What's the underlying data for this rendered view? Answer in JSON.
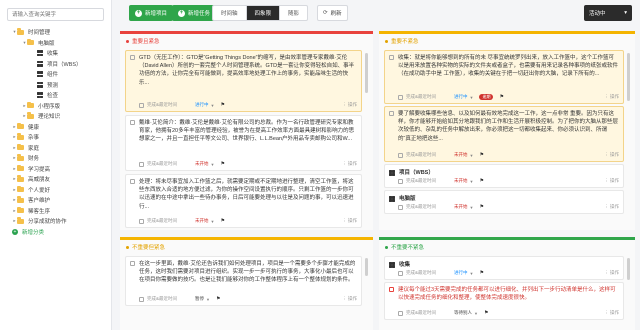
{
  "sidebar": {
    "search_placeholder": "请输入查询关键字",
    "tree": [
      {
        "label": "时间管理",
        "type": "folder",
        "arrow": "▾",
        "indent": 0
      },
      {
        "label": "电脑版",
        "type": "folder",
        "arrow": "▾",
        "indent": 1
      },
      {
        "label": "收集",
        "type": "grid",
        "arrow": "",
        "indent": 2
      },
      {
        "label": "项目（WBS）",
        "type": "grid",
        "arrow": "",
        "indent": 2
      },
      {
        "label": "组件",
        "type": "grid",
        "arrow": "",
        "indent": 2
      },
      {
        "label": "预测",
        "type": "grid",
        "arrow": "",
        "indent": 2
      },
      {
        "label": "检查",
        "type": "grid",
        "arrow": "",
        "indent": 2
      },
      {
        "label": "小程序版",
        "type": "folder",
        "arrow": "▸",
        "indent": 1
      },
      {
        "label": "理论知识",
        "type": "folder",
        "arrow": "▸",
        "indent": 1
      },
      {
        "label": "健康",
        "type": "folder",
        "arrow": "▸",
        "indent": 0
      },
      {
        "label": "杂事",
        "type": "folder",
        "arrow": "▸",
        "indent": 0
      },
      {
        "label": "家庭",
        "type": "folder",
        "arrow": "▸",
        "indent": 0
      },
      {
        "label": "财务",
        "type": "folder",
        "arrow": "▸",
        "indent": 0
      },
      {
        "label": "学习提高",
        "type": "folder",
        "arrow": "▸",
        "indent": 0
      },
      {
        "label": "高威朋友",
        "type": "folder",
        "arrow": "▸",
        "indent": 0
      },
      {
        "label": "个人爱好",
        "type": "folder",
        "arrow": "▸",
        "indent": 0
      },
      {
        "label": "客户维护",
        "type": "folder",
        "arrow": "▸",
        "indent": 0
      },
      {
        "label": "稀客生序",
        "type": "folder",
        "arrow": "▸",
        "indent": 0
      },
      {
        "label": "分享成就的协作",
        "type": "folder",
        "arrow": "▸",
        "indent": 0
      }
    ],
    "add_category": "新增分类"
  },
  "toolbar": {
    "add_project": "新增项目",
    "add_task": "新增任务",
    "views": [
      "时间轴",
      "四象限",
      "随影"
    ],
    "active_view": 1,
    "refresh": "刷新",
    "status": "活动中"
  },
  "q1": {
    "title": "重要且紧急",
    "cards": [
      {
        "text": "GTD（无压工作）：GTD是“Getting Things Done”的缩写，是由效率管理专家戴维·艾伦（David Allen）所创的一套完整个人时间管理系统。GTD是一套让你变得轻松自如、事半功倍的方法，让你完全有可能做到，提高效率地处理工作上的事务，实能品味生活的快乐...",
        "date": "完成&最近时间",
        "tag": "进行中",
        "tag_color": "blue",
        "ops": "操作"
      },
      {
        "text": "戴维·艾伦简介：戴维·艾伦是戴维·艾伦有限公司的总裁。作为一名行政管理研究专家和教育家，他拥有20多年丰富的管理经验，被誉为在提高工作效率方面最具建树和影响力的思想家之一，并且一直担任平等文公司、世界银行、L.L.Bean户外用品专卖邮购公司和W...",
        "date": "完成&最近时间",
        "tag": "未开始",
        "tag_color": "red",
        "ops": "操作"
      },
      {
        "text": "处理：将未尽事宜加入工作篮之后，就需要定期或不定期地进行整理，清空工作篮，将这些东西放入合适的地方便过滤，为你的操作空间设置执行的顺序。只剩工作篮的一步你可以迅速的在中途中拿出一些待办事务，日后可能要处理与以往是及问题的事，可以迅速进行...",
        "date": "完成&最近时间",
        "tag": "未开始",
        "tag_color": "red",
        "ops": "操作"
      }
    ]
  },
  "q2": {
    "title": "重要不紧急",
    "cards": [
      {
        "text": "收集：就是将你能够想到的所有的未 尽事宜统统罗列出来，放入工作篮中，这个工作篮可以是用来放置各种实物的实际的文件夹或者盒子，也需要有用来记录各种事项的纸张或软件（在成功助手中是 工作篮），收集的关键在于把一切赶出你的大脑，记录下所有的...",
        "date": "完成&最近时间",
        "tag": "进行中",
        "tag_color": "blue",
        "badge": "逾期",
        "ops": "操作"
      },
      {
        "text": "要了解要收集哪些信息、以及如何最有效地完成这一工作，这一点非常 重要。因为只有这样，你才能够开始给如其分地跟我们的工作和生活开展积极控制。为了把你的大脑从那些层次较低的、杂乱的任务中解放出来，你必须把这一切都收集起来、你必须认识到、所谓的“真正地把这些...",
        "date": "完成&最近时间",
        "tag": "未开始",
        "tag_color": "red",
        "ops": "操作"
      },
      {
        "text": "项目（WBS）",
        "simple": true,
        "date": "完成&最近时间",
        "tag": "未开始",
        "tag_color": "red",
        "ops": "操作"
      },
      {
        "text": "电脑版",
        "simple": true,
        "date": "完成&最近时间",
        "tag": "未开始",
        "tag_color": "red",
        "ops": "操作"
      }
    ]
  },
  "q3": {
    "title": "不重要但紧急",
    "cards": [
      {
        "text": "在这一步里面，戴维·艾伦还告诉我们如何处理项目，项目是一个需要多个步骤才能完成的任务，这时我们需要对项目进行组织。实现一步一步可执行的事务，大事化小最后也可以在项目你需要做的技巧。也是让我们能够对你的工作整体程序上有一个整体规划的条件。",
        "date": "完成&最近时间",
        "tag": "暂停",
        "tag_color": "dark",
        "ops": "操作"
      }
    ]
  },
  "q4": {
    "title": "不重要不紧急",
    "cards": [
      {
        "text": "收集",
        "simple": true,
        "date": "完成&最近时间",
        "tag": "进行中",
        "tag_color": "blue",
        "ops": "操作"
      },
      {
        "text": "建议每个能过3天需要完成的任务都可以进行细化、并列出下一步行动清单是什么，这样可以快速完成任务的细化和整理，使整体完成速度很快。",
        "date": "完成&最近时间",
        "tag": "等待别人",
        "tag_color": "dark",
        "ops": "操作",
        "red": true
      }
    ]
  }
}
